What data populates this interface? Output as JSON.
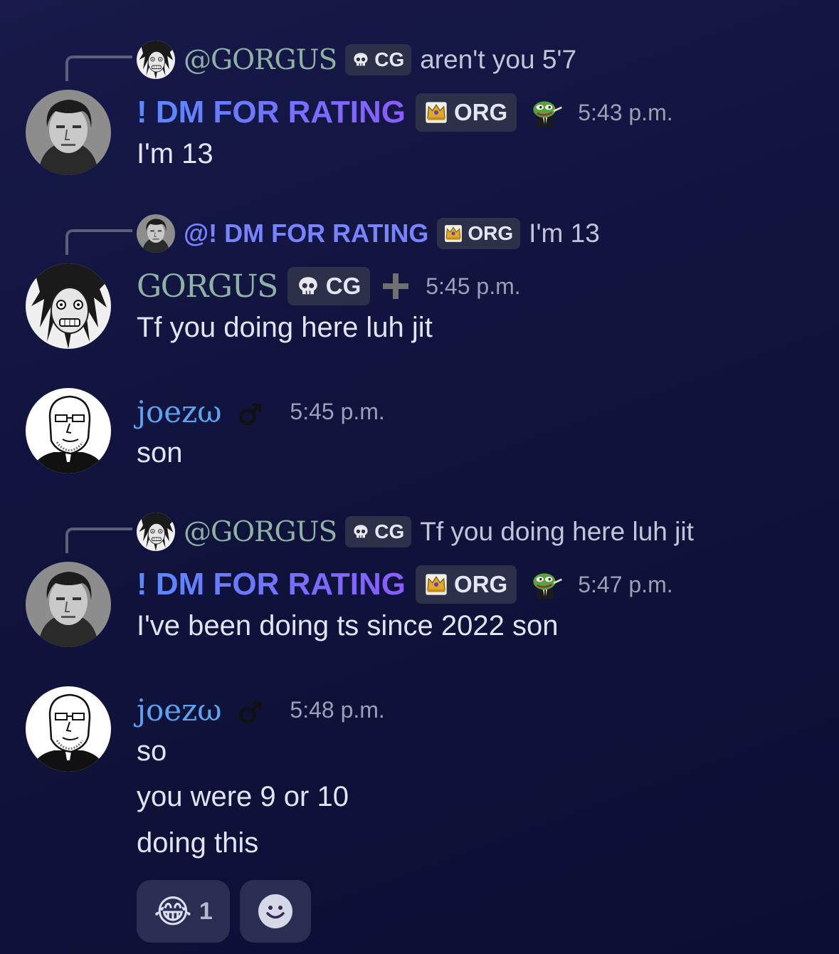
{
  "messages": [
    {
      "reply": {
        "mention": "@GORGUS",
        "badge": "CG",
        "text": "aren't you 5'7"
      },
      "author": "! DM FOR RATING",
      "badge": "ORG",
      "emoji_icon": "pepe-suit-icon",
      "time": "5:43 p.m.",
      "lines": [
        "I'm 13"
      ]
    },
    {
      "reply": {
        "mention": "@! DM FOR RATING",
        "badge": "ORG",
        "text": "I'm 13"
      },
      "author": "GORGUS",
      "badge": "CG",
      "emoji_icon": "plus-icon",
      "time": "5:45 p.m.",
      "lines": [
        "Tf you doing here luh jit"
      ]
    },
    {
      "author": "joezω",
      "emoji_icon": "male-sign-icon",
      "male_sign": "♂",
      "time": "5:45 p.m.",
      "lines": [
        "son"
      ]
    },
    {
      "reply": {
        "mention": "@GORGUS",
        "badge": "CG",
        "text": "Tf you doing here luh jit"
      },
      "author": "! DM FOR RATING",
      "badge": "ORG",
      "emoji_icon": "pepe-suit-icon",
      "time": "5:47 p.m.",
      "lines": [
        "I've been doing ts since 2022 son"
      ]
    },
    {
      "author": "joezω",
      "emoji_icon": "male-sign-icon",
      "male_sign": "♂",
      "time": "5:48 p.m.",
      "lines": [
        "so",
        "you were 9 or 10",
        "doing this"
      ],
      "reactions": [
        {
          "emoji": "😂",
          "icon": "joy-emoji-icon",
          "count": "1"
        },
        {
          "icon": "add-reaction-icon"
        }
      ]
    }
  ],
  "colors": {
    "background": "#10133c",
    "name_gradient_start": "#5a8bff",
    "name_gradient_end": "#8a5cff",
    "gorgus_name": "#8fb2a4",
    "joe_name": "#5fa3ee",
    "badge_bg": "#2c3048"
  }
}
